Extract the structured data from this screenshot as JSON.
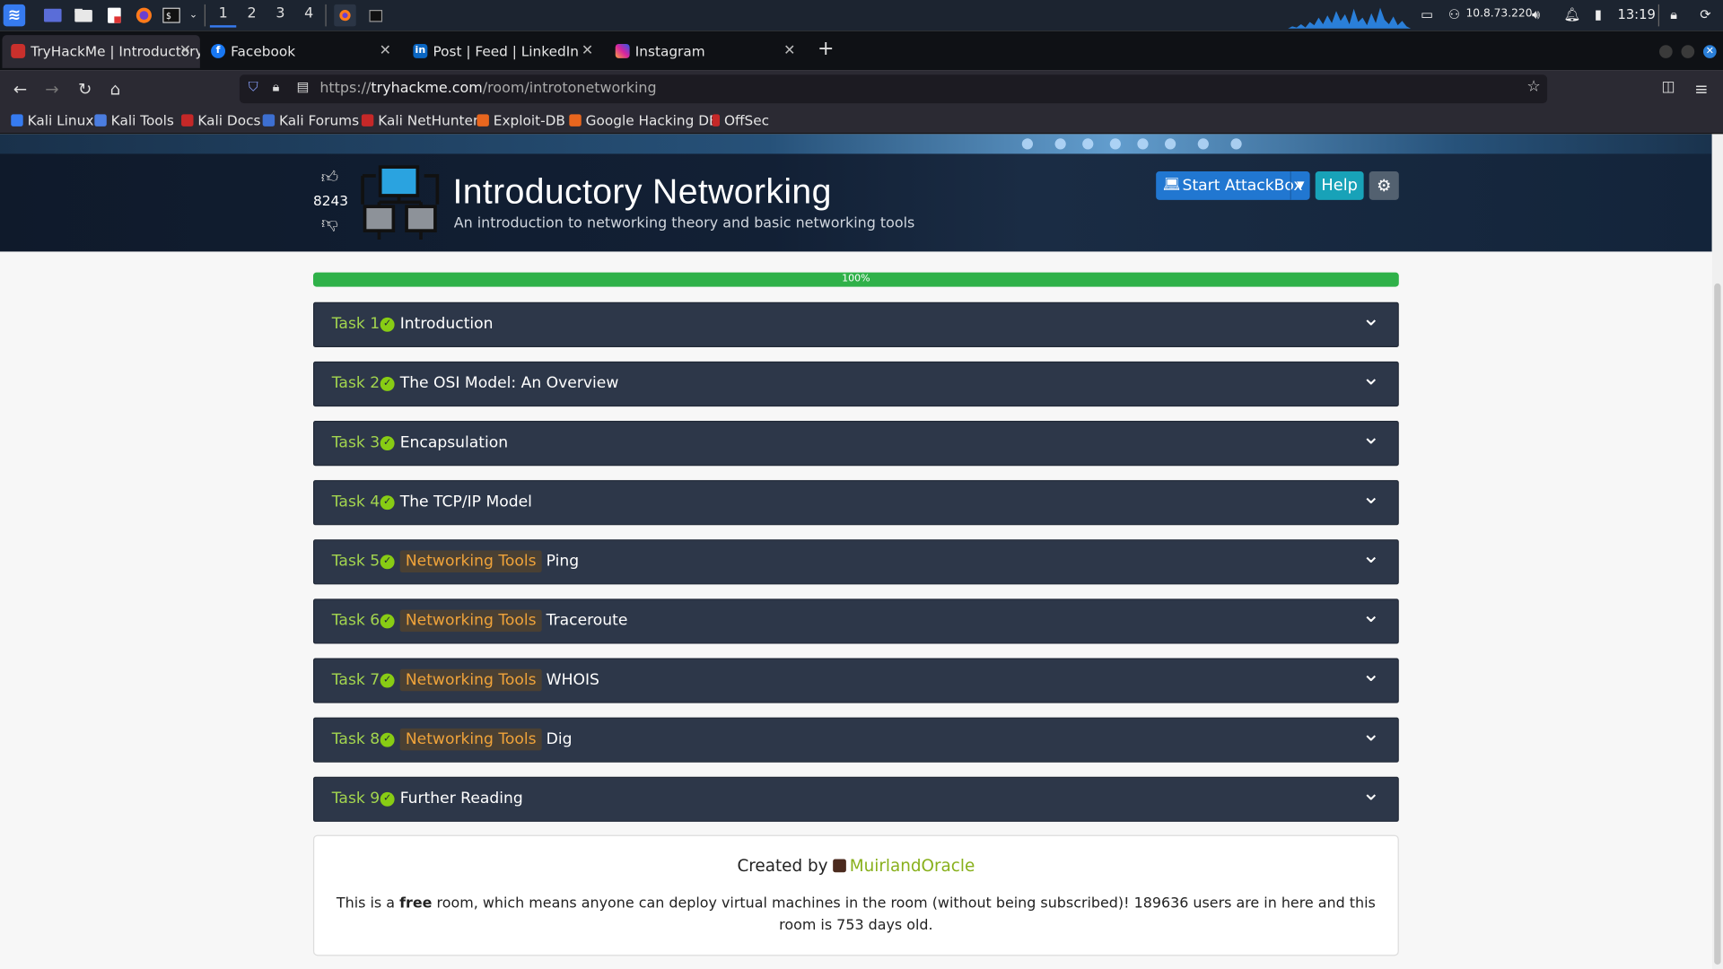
{
  "taskbar": {
    "workspaces": [
      "1",
      "2",
      "3",
      "4"
    ],
    "ip": "10.8.73.220",
    "time": "13:19"
  },
  "tabs": [
    {
      "label": "TryHackMe | Introductory",
      "active": true
    },
    {
      "label": "Facebook"
    },
    {
      "label": "Post | Feed | LinkedIn"
    },
    {
      "label": "Instagram"
    }
  ],
  "urlbar": {
    "prefix": "https://",
    "host": "tryhackme.com",
    "path": "/room/introtonetworking"
  },
  "bookmarks": [
    "Kali Linux",
    "Kali Tools",
    "Kali Docs",
    "Kali Forums",
    "Kali NetHunter",
    "Exploit-DB",
    "Google Hacking DB",
    "OffSec"
  ],
  "room": {
    "votes": "8243",
    "title": "Introductory Networking",
    "subtitle": "An introduction to networking theory and basic networking tools",
    "attackbox_label": "Start AttackBox",
    "help_label": "Help",
    "progress_text": "100%",
    "progress": 1.0
  },
  "tasks": [
    {
      "num": "Task 1",
      "tag": "",
      "name": "Introduction"
    },
    {
      "num": "Task 2",
      "tag": "",
      "name": "The OSI Model: An Overview"
    },
    {
      "num": "Task 3",
      "tag": "",
      "name": "Encapsulation"
    },
    {
      "num": "Task 4",
      "tag": "",
      "name": "The TCP/IP Model"
    },
    {
      "num": "Task 5",
      "tag": "Networking Tools",
      "name": "Ping"
    },
    {
      "num": "Task 6",
      "tag": "Networking Tools",
      "name": "Traceroute"
    },
    {
      "num": "Task 7",
      "tag": "Networking Tools",
      "name": "WHOIS"
    },
    {
      "num": "Task 8",
      "tag": "Networking Tools",
      "name": "Dig"
    },
    {
      "num": "Task 9",
      "tag": "",
      "name": "Further Reading"
    }
  ],
  "footer": {
    "created_by": "Created by",
    "author": "MuirlandOracle",
    "desc_pre": "This is a ",
    "desc_free": "free",
    "desc_post": " room, which means anyone can deploy virtual machines in the room (without being subscribed)! 189636 users are in here and this room is 753 days old."
  },
  "colors": {
    "accent": "#88cc14",
    "task_bg": "#2d3749",
    "tag_text": "#f0a33a",
    "progress": "#2fb149"
  }
}
